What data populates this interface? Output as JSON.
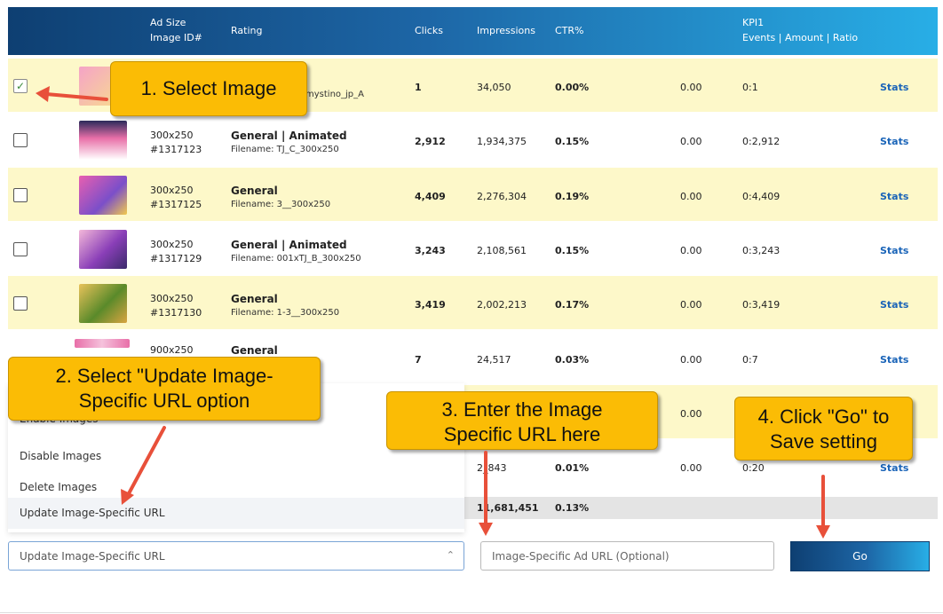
{
  "header": {
    "ad_size": "Ad Size",
    "image_id": "Image ID#",
    "rating": "Rating",
    "clicks": "Clicks",
    "impressions": "Impressions",
    "ctr": "CTR%",
    "kpi": "KPI1",
    "kpi_sub": "Events | Amount | Ratio"
  },
  "rows": [
    {
      "size": "",
      "id": "",
      "rating": "",
      "filename": "_mystino_jp_A",
      "clicks": "1",
      "impressions": "34,050",
      "ctr": "0.00%",
      "amount": "0.00",
      "ratio": "0:1",
      "stats": "Stats",
      "checked": true
    },
    {
      "size": "300x250",
      "id": "#1317123",
      "rating": "General | Animated",
      "filename": "Filename: TJ_C_300x250",
      "clicks": "2,912",
      "impressions": "1,934,375",
      "ctr": "0.15%",
      "amount": "0.00",
      "ratio": "0:2,912",
      "stats": "Stats",
      "checked": false
    },
    {
      "size": "300x250",
      "id": "#1317125",
      "rating": "General",
      "filename": "Filename: 3__300x250",
      "clicks": "4,409",
      "impressions": "2,276,304",
      "ctr": "0.19%",
      "amount": "0.00",
      "ratio": "0:4,409",
      "stats": "Stats",
      "checked": false
    },
    {
      "size": "300x250",
      "id": "#1317129",
      "rating": "General | Animated",
      "filename": "Filename: 001xTJ_B_300x250",
      "clicks": "3,243",
      "impressions": "2,108,561",
      "ctr": "0.15%",
      "amount": "0.00",
      "ratio": "0:3,243",
      "stats": "Stats",
      "checked": false
    },
    {
      "size": "300x250",
      "id": "#1317130",
      "rating": "General",
      "filename": "Filename: 1-3__300x250",
      "clicks": "3,419",
      "impressions": "2,002,213",
      "ctr": "0.17%",
      "amount": "0.00",
      "ratio": "0:3,419",
      "stats": "Stats",
      "checked": false
    },
    {
      "size": "900x250",
      "id": "",
      "rating": "General",
      "filename": "",
      "clicks": "7",
      "impressions": "24,517",
      "ctr": "0.03%",
      "amount": "0.00",
      "ratio": "0:7",
      "stats": "Stats",
      "checked": false
    },
    {
      "amount": "0.00"
    },
    {
      "impressions": "2_843",
      "ctr": "0.01%",
      "amount": "0.00",
      "ratio": "0:20",
      "stats": "Stats"
    }
  ],
  "totals": {
    "impressions": "11,681,451",
    "ctr": "0.13%"
  },
  "menu": {
    "items": [
      "Enable Images",
      "Disable Images",
      "Delete Images",
      "Update Image-Specific URL"
    ]
  },
  "bulk_action": {
    "selected": "Update Image-Specific URL"
  },
  "url_input": {
    "placeholder": "Image-Specific Ad URL (Optional)"
  },
  "go_button": {
    "label": "Go"
  },
  "callouts": {
    "step1": "1. Select Image",
    "step2_line1": "2. Select \"Update Image-",
    "step2_line2": "Specific URL option",
    "step3_line1": "3. Enter the Image",
    "step3_line2": "Specific URL here",
    "step4_line1": "4. Click \"Go\" to",
    "step4_line2": "Save setting"
  },
  "colors": {
    "header_dark": "#0e3f72",
    "header_light": "#28aee6",
    "row_highlight": "#fdf8c9",
    "callout": "#fbbc05",
    "arrow": "#e8503a",
    "stats_link": "#1a64b8"
  }
}
